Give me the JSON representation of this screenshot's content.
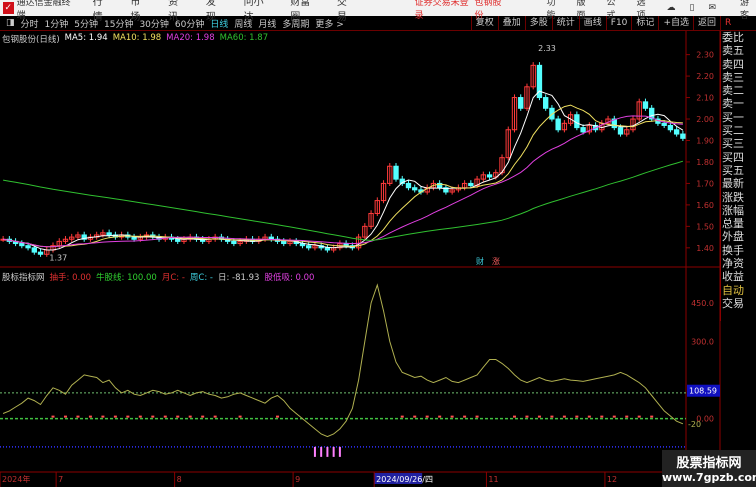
{
  "app": {
    "title": "通达信金融终端",
    "menus": [
      "行情",
      "市场",
      "资讯",
      "发现",
      "问小达",
      "财富圈",
      "交易"
    ],
    "warning": "证券交易未登录",
    "stock_name": "包钢股份",
    "right_menus": [
      "功能",
      "版面",
      "公式",
      "选项"
    ],
    "user": "游客"
  },
  "toolbar": {
    "periods": [
      "分时",
      "1分钟",
      "5分钟",
      "15分钟",
      "30分钟",
      "60分钟",
      "日线",
      "周线",
      "月线",
      "多周期",
      "更多 >"
    ],
    "selected": "日线",
    "right_buttons": [
      "复权",
      "叠加",
      "多股",
      "统计",
      "画线",
      "F10",
      "标记",
      "+自选",
      "返回"
    ]
  },
  "main_legend": {
    "title": "包钢股份(日线)",
    "ma5": "MA5: 1.94",
    "ma10": "MA10: 1.98",
    "ma20": "MA20: 1.98",
    "ma60": "MA60: 1.87"
  },
  "indicator_legend": {
    "title": "股标指标网",
    "a": "抽手: 0.00",
    "b": "牛股线: 100.00",
    "c": "月C: -",
    "d": "周C: -",
    "e": "日: -81.93",
    "f": "股低吸: 0.00"
  },
  "side_panel": [
    "委比",
    "卖五",
    "卖四",
    "卖三",
    "卖二",
    "卖一",
    "买一",
    "买二",
    "买三",
    "买四",
    "买五",
    "最新",
    "涨跌",
    "涨幅",
    "总量",
    "外盘",
    "换手",
    "净资",
    "收益",
    "自动",
    "交易"
  ],
  "markers": {
    "high": "2.33",
    "low": "1.37",
    "cai": "财",
    "zhang": "涨"
  },
  "colors": {
    "up": "#ff3b3b",
    "down": "#54ffff",
    "ma5": "#ffffff",
    "ma10": "#f0e060",
    "ma20": "#e040e0",
    "ma60": "#30c030",
    "indicator": "#b0b050"
  },
  "watermark": {
    "line1": "股票指标网",
    "line2": "www.7gpzb.com"
  },
  "chart_data": [
    {
      "type": "candlestick",
      "title": "包钢股份(日线)",
      "ylim": [
        1.32,
        2.41
      ],
      "yticks": [
        "2.30",
        "2.20",
        "2.10",
        "2.00",
        "1.90",
        "1.80",
        "1.70",
        "1.60",
        "1.50",
        "1.40"
      ],
      "closes": [
        1.44,
        1.43,
        1.42,
        1.41,
        1.4,
        1.38,
        1.37,
        1.39,
        1.41,
        1.43,
        1.44,
        1.45,
        1.46,
        1.44,
        1.45,
        1.46,
        1.47,
        1.46,
        1.45,
        1.46,
        1.45,
        1.44,
        1.45,
        1.46,
        1.45,
        1.44,
        1.45,
        1.44,
        1.43,
        1.44,
        1.45,
        1.44,
        1.43,
        1.44,
        1.45,
        1.44,
        1.43,
        1.42,
        1.43,
        1.44,
        1.43,
        1.44,
        1.45,
        1.44,
        1.43,
        1.42,
        1.43,
        1.42,
        1.41,
        1.4,
        1.41,
        1.4,
        1.39,
        1.4,
        1.42,
        1.41,
        1.4,
        1.45,
        1.5,
        1.56,
        1.62,
        1.7,
        1.78,
        1.72,
        1.7,
        1.68,
        1.67,
        1.66,
        1.68,
        1.7,
        1.68,
        1.66,
        1.67,
        1.68,
        1.7,
        1.69,
        1.72,
        1.74,
        1.73,
        1.75,
        1.82,
        1.95,
        2.1,
        2.05,
        2.15,
        2.25,
        2.1,
        2.05,
        2.0,
        1.95,
        1.98,
        2.02,
        1.96,
        1.94,
        1.97,
        1.95,
        1.98,
        2.0,
        1.96,
        1.93,
        1.95,
        2.0,
        2.08,
        2.05,
        2.0,
        1.98,
        1.97,
        1.95,
        1.93,
        1.91
      ],
      "ma60_start": 1.72
    },
    {
      "type": "line",
      "title": "股标指标网",
      "ylim": [
        -200,
        520
      ],
      "yticks": [
        "450.0",
        "300.0",
        "0.00"
      ],
      "current": "108.59",
      "end_label": "-20",
      "values": [
        20,
        30,
        45,
        60,
        80,
        70,
        55,
        90,
        120,
        110,
        95,
        130,
        150,
        170,
        165,
        160,
        140,
        150,
        120,
        100,
        110,
        95,
        90,
        100,
        110,
        105,
        95,
        100,
        110,
        100,
        90,
        100,
        105,
        95,
        90,
        80,
        85,
        95,
        100,
        90,
        80,
        70,
        60,
        80,
        90,
        70,
        40,
        20,
        0,
        -20,
        -40,
        -60,
        -70,
        -60,
        -40,
        -10,
        40,
        150,
        300,
        450,
        520,
        420,
        300,
        220,
        180,
        170,
        160,
        165,
        150,
        140,
        150,
        160,
        145,
        140,
        150,
        160,
        170,
        200,
        230,
        230,
        215,
        195,
        170,
        150,
        140,
        150,
        160,
        150,
        145,
        150,
        155,
        150,
        148,
        145,
        150,
        155,
        160,
        165,
        170,
        180,
        170,
        155,
        140,
        120,
        90,
        60,
        30,
        10,
        -10,
        -20
      ],
      "levels": {
        "green_dashed": 0,
        "blue_dotted": -110,
        "light_green": 100
      },
      "xlabels": [
        {
          "i": 0,
          "t": "2024年"
        },
        {
          "i": 9,
          "t": "7"
        },
        {
          "i": 28,
          "t": "8"
        },
        {
          "i": 47,
          "t": "9"
        },
        {
          "i": 60,
          "t": "2024/09/26/四"
        },
        {
          "i": 78,
          "t": "11"
        },
        {
          "i": 97,
          "t": "12"
        }
      ]
    }
  ]
}
